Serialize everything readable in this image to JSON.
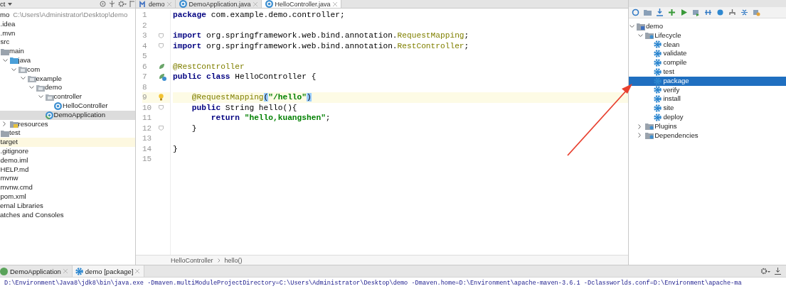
{
  "project_panel": {
    "title": "ct",
    "tree": [
      {
        "label": "mo",
        "path": "C:\\Users\\Administrator\\Desktop\\demo",
        "selected": false,
        "children": [
          {
            "label": ".idea",
            "selected": false
          },
          {
            "label": ".mvn",
            "selected": false
          },
          {
            "label": "src",
            "selected": false,
            "children": [
              {
                "label": "main",
                "kind": "folder",
                "selected": false,
                "children": [
                  {
                    "label": "java",
                    "kind": "source-folder",
                    "expanded": true,
                    "selected": false,
                    "children": [
                      {
                        "label": "com",
                        "kind": "package",
                        "expanded": true,
                        "selected": false,
                        "children": [
                          {
                            "label": "example",
                            "kind": "package",
                            "expanded": true,
                            "selected": false,
                            "children": [
                              {
                                "label": "demo",
                                "kind": "package",
                                "expanded": true,
                                "selected": false,
                                "children": [
                                  {
                                    "label": "controller",
                                    "kind": "package",
                                    "expanded": true,
                                    "selected": false,
                                    "children": [
                                      {
                                        "label": "HelloController",
                                        "kind": "class",
                                        "selected": false
                                      }
                                    ]
                                  },
                                  {
                                    "label": "DemoApplication",
                                    "kind": "app-class",
                                    "selected": true
                                  }
                                ]
                              }
                            ]
                          }
                        ]
                      }
                    ]
                  },
                  {
                    "label": "resources",
                    "kind": "resource-folder",
                    "expanded": false,
                    "selected": false
                  }
                ]
              },
              {
                "label": "test",
                "kind": "folder",
                "selected": false
              }
            ]
          },
          {
            "label": "target",
            "kind": "excluded-folder",
            "selected": false
          },
          {
            "label": ".gitignore",
            "selected": false
          },
          {
            "label": "demo.iml",
            "selected": false
          },
          {
            "label": "HELP.md",
            "selected": false
          },
          {
            "label": "mvnw",
            "selected": false
          },
          {
            "label": "mvnw.cmd",
            "selected": false
          },
          {
            "label": "pom.xml",
            "selected": false
          }
        ]
      },
      {
        "label": "ernal Libraries",
        "selected": false
      },
      {
        "label": "atches and Consoles",
        "selected": false
      }
    ]
  },
  "editor": {
    "tabs": [
      {
        "label": "demo",
        "kind": "maven",
        "selected": false
      },
      {
        "label": "DemoApplication.java",
        "kind": "class",
        "selected": false
      },
      {
        "label": "HelloController.java",
        "kind": "class",
        "selected": true
      }
    ],
    "lines": [
      {
        "number": "1",
        "kind": "plain",
        "tokens": [
          {
            "text": "package",
            "kind": "keyword"
          },
          {
            "text": " com.example.demo.controller;",
            "kind": "plain"
          }
        ]
      },
      {
        "number": "2",
        "kind": "plain"
      },
      {
        "number": "3",
        "kind": "plain",
        "fold": true,
        "tokens": [
          {
            "text": "import",
            "kind": "keyword"
          },
          {
            "text": " org.springframework.web.bind.annotation.",
            "kind": "plain"
          },
          {
            "text": "RequestMapping",
            "kind": "annotation"
          },
          {
            "text": ";",
            "kind": "plain"
          }
        ]
      },
      {
        "number": "4",
        "kind": "plain",
        "fold": true,
        "tokens": [
          {
            "text": "import",
            "kind": "keyword"
          },
          {
            "text": " org.springframework.web.bind.annotation.",
            "kind": "plain"
          },
          {
            "text": "RestController",
            "kind": "annotation"
          },
          {
            "text": ";",
            "kind": "plain"
          }
        ]
      },
      {
        "number": "5",
        "kind": "plain"
      },
      {
        "number": "6",
        "kind": "bean",
        "tokens": [
          {
            "text": "@RestController",
            "kind": "annotation"
          }
        ]
      },
      {
        "number": "7",
        "kind": "bean-class",
        "tokens": [
          {
            "text": "public class",
            "kind": "keyword"
          },
          {
            "text": " HelloController {",
            "kind": "plain"
          }
        ]
      },
      {
        "number": "8",
        "kind": "plain"
      },
      {
        "number": "9",
        "kind": "bulb",
        "current": true,
        "tokens": [
          {
            "text": "    @RequestMapping",
            "kind": "annotation"
          },
          {
            "text": "(",
            "kind": "match"
          },
          {
            "text": "\"/hello\"",
            "kind": "string"
          },
          {
            "text": ")",
            "kind": "match"
          }
        ]
      },
      {
        "number": "10",
        "kind": "plain",
        "fold": true,
        "tokens": [
          {
            "text": "    public",
            "kind": "keyword"
          },
          {
            "text": " String hello(){",
            "kind": "plain"
          }
        ]
      },
      {
        "number": "11",
        "kind": "plain",
        "tokens": [
          {
            "text": "        return ",
            "kind": "keyword"
          },
          {
            "text": "\"hello,kuangshen\"",
            "kind": "string"
          },
          {
            "text": ";",
            "kind": "plain"
          }
        ]
      },
      {
        "number": "12",
        "kind": "plain",
        "fold": true,
        "tokens": [
          {
            "text": "    }",
            "kind": "plain"
          }
        ]
      },
      {
        "number": "13",
        "kind": "plain"
      },
      {
        "number": "14",
        "kind": "plain",
        "tokens": [
          {
            "text": "}",
            "kind": "plain"
          }
        ]
      },
      {
        "number": "15",
        "kind": "plain"
      }
    ],
    "breadcrumbs": [
      "HelloController",
      "hello()"
    ]
  },
  "maven_panel": {
    "tree": [
      {
        "label": "demo",
        "kind": "project",
        "expanded": true,
        "selected": false,
        "children": [
          {
            "label": "Lifecycle",
            "kind": "group",
            "expanded": true,
            "selected": false,
            "children": [
              {
                "label": "clean",
                "kind": "goal",
                "selected": false
              },
              {
                "label": "validate",
                "kind": "goal",
                "selected": false
              },
              {
                "label": "compile",
                "kind": "goal",
                "selected": false
              },
              {
                "label": "test",
                "kind": "goal",
                "selected": false
              },
              {
                "label": "package",
                "kind": "goal",
                "selected": true
              },
              {
                "label": "verify",
                "kind": "goal",
                "selected": false
              },
              {
                "label": "install",
                "kind": "goal",
                "selected": false
              },
              {
                "label": "site",
                "kind": "goal",
                "selected": false
              },
              {
                "label": "deploy",
                "kind": "goal",
                "selected": false
              }
            ]
          },
          {
            "label": "Plugins",
            "kind": "group",
            "expanded": false,
            "selected": false
          },
          {
            "label": "Dependencies",
            "kind": "group",
            "expanded": false,
            "selected": false
          }
        ]
      }
    ]
  },
  "run_panel": {
    "tabs": [
      {
        "label": "DemoApplication",
        "kind": "app",
        "selected": false
      },
      {
        "label": "demo [package]",
        "kind": "maven-goal",
        "selected": true
      }
    ],
    "console": [
      "D:\\Environment\\Java8\\jdk8\\bin\\java.exe -Dmaven.multiModuleProjectDirectory=C:\\Users\\Administrator\\Desktop\\demo -Dmaven.home=D:\\Environment\\apache-maven-3.6.1 -Dclassworlds.conf=D:\\Environment\\apache-ma"
    ]
  }
}
